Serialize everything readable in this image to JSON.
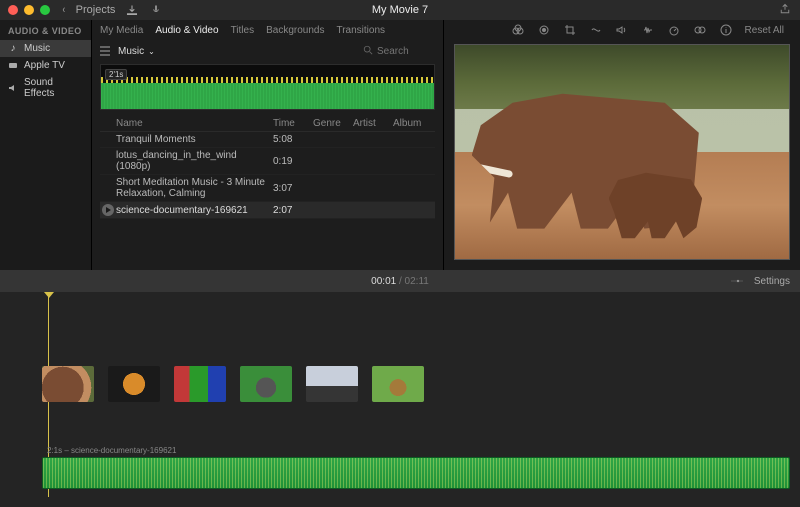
{
  "window": {
    "back_label": "Projects",
    "title": "My Movie 7"
  },
  "sidebar": {
    "heading": "AUDIO & VIDEO",
    "items": [
      {
        "label": "Music",
        "icon": "music-note-icon",
        "active": true
      },
      {
        "label": "Apple TV",
        "icon": "apple-tv-icon",
        "active": false
      },
      {
        "label": "Sound Effects",
        "icon": "speaker-icon",
        "active": false
      }
    ]
  },
  "browser": {
    "tabs": [
      {
        "label": "My Media"
      },
      {
        "label": "Audio & Video",
        "active": true
      },
      {
        "label": "Titles"
      },
      {
        "label": "Backgrounds"
      },
      {
        "label": "Transitions"
      }
    ],
    "source_label": "Music",
    "search_placeholder": "Search",
    "waveform_tag": "2'1s",
    "columns": {
      "name": "Name",
      "time": "Time",
      "genre": "Genre",
      "artist": "Artist",
      "album": "Album"
    },
    "tracks": [
      {
        "name": "Tranquil Moments",
        "time": "5:08"
      },
      {
        "name": "lotus_dancing_in_the_wind (1080p)",
        "time": "0:19"
      },
      {
        "name": "Short Meditation Music - 3 Minute Relaxation, Calming",
        "time": "3:07"
      },
      {
        "name": "science-documentary-169621",
        "time": "2:07",
        "selected": true
      }
    ]
  },
  "viewer": {
    "reset_label": "Reset All",
    "tools": [
      "color-balance-icon",
      "color-correct-icon",
      "crop-icon",
      "stabilize-icon",
      "volume-icon",
      "noise-icon",
      "speed-icon",
      "filter-icon",
      "info-icon"
    ]
  },
  "timeline": {
    "current": "00:01",
    "total": "02:11",
    "settings_label": "Settings",
    "audio_clip_label": "2:1s – science-documentary-169621",
    "clips": [
      "elephants",
      "tiger",
      "parrots",
      "ape",
      "penguin",
      "impala"
    ]
  }
}
